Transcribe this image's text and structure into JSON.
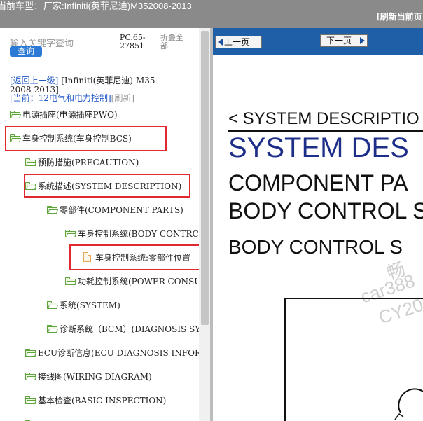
{
  "topbar": {
    "label": "当前车型：",
    "vehicle": "厂家:Infiniti(英菲尼迪)M352008-2013"
  },
  "search": {
    "placeholder": "输入关键字查询",
    "button": "查询"
  },
  "code": "PC.65-27851",
  "collapse_all": "折叠全部",
  "breadcrumb": {
    "back_link": "[返回上一级]",
    "path": "[Infiniti(英菲尼迪)-M35-2008-2013]"
  },
  "current": {
    "prefix": "[当前：",
    "value": "12电气和电力控制]",
    "refresh": "[刷新]"
  },
  "tree": [
    {
      "label": "电源插座(电源插座PWO)",
      "type": "folder"
    },
    {
      "label": "车身控制系统(车身控制BCS)",
      "type": "folder"
    },
    {
      "label": "预防措施(PRECAUTION)",
      "type": "folder"
    },
    {
      "label": "系统描述(SYSTEM DESCRIPTION)",
      "type": "folder"
    },
    {
      "label": "零部件(COMPONENT PARTS)",
      "type": "folder"
    },
    {
      "label": "车身控制系统(BODY CONTRC",
      "type": "folder"
    },
    {
      "label": "车身控制系统:零部件位置",
      "type": "document"
    },
    {
      "label": "功耗控制系统(POWER CONSU",
      "type": "folder"
    },
    {
      "label": "系统(SYSTEM)",
      "type": "folder"
    },
    {
      "label": "诊断系统（BCM）(DIAGNOSIS SY",
      "type": "folder"
    },
    {
      "label": "ECU诊断信息(ECU DIAGNOSIS INFORM",
      "type": "folder"
    },
    {
      "label": "接线图(WIRING DIAGRAM)",
      "type": "folder"
    },
    {
      "label": "基本检查(BASIC INSPECTION)",
      "type": "folder"
    }
  ],
  "viewer": {
    "prev": "上一页",
    "next": "下一页",
    "refresh_page": "[刷新当前页"
  },
  "document": {
    "line1": "< SYSTEM DESCRIPTIO",
    "line2": "SYSTEM DES",
    "line3": "COMPONENT PA",
    "line4": "BODY CONTROL S",
    "line5": "BODY CONTROL S",
    "watermarks": [
      "畅",
      "car388",
      "CY20"
    ]
  },
  "colors": {
    "highlight": "#e0282e",
    "folder_icon": "#5ea63c",
    "doc_icon": "#e2a65b",
    "link": "#1f56c8",
    "toolbar": "#1e5fa8",
    "title_blue": "#1e2f8a"
  }
}
